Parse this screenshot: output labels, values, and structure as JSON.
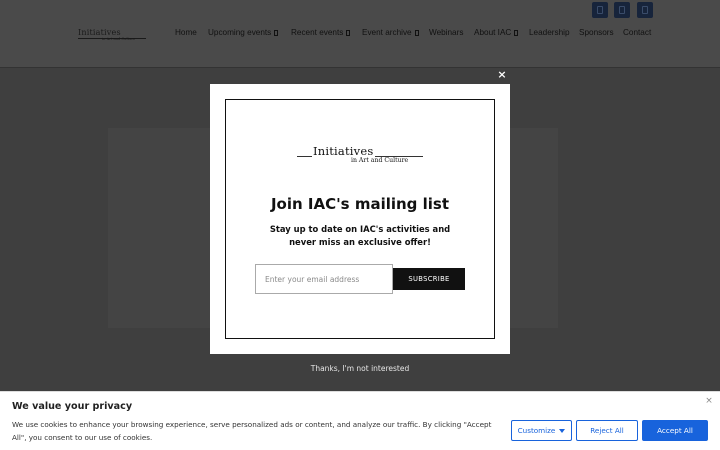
{
  "site": {
    "logo_main": "Initiatives",
    "logo_sub": "in Art and Culture",
    "nav": [
      {
        "label": "Home",
        "has_dropdown": false
      },
      {
        "label": "Upcoming events",
        "has_dropdown": true
      },
      {
        "label": "Recent events",
        "has_dropdown": true
      },
      {
        "label": "Event archive",
        "has_dropdown": true
      },
      {
        "label": "Webinars",
        "has_dropdown": false
      },
      {
        "label": "About IAC",
        "has_dropdown": true
      },
      {
        "label": "Leadership",
        "has_dropdown": false
      },
      {
        "label": "Sponsors",
        "has_dropdown": false
      },
      {
        "label": "Contact",
        "has_dropdown": false
      }
    ],
    "social_icons": [
      "social-icon",
      "social-icon",
      "social-icon"
    ]
  },
  "popup": {
    "close_label": "×",
    "logo_main": "Initiatives",
    "logo_sub": "in Art and Culture",
    "title": "Join IAC's mailing list",
    "text": "Stay up to date on IAC's activities and never miss an exclusive offer!",
    "email_placeholder": "Enter your email address",
    "email_value": "",
    "subscribe_label": "SUBSCRIBE",
    "dismiss_label": "Thanks, I'm not interested"
  },
  "cookie": {
    "title": "We value your privacy",
    "text": "We use cookies to enhance your browsing experience, serve personalized ads or content, and analyze our traffic. By clicking \"Accept All\", you consent to our use of cookies.",
    "close_label": "×",
    "customize_label": "Customize",
    "reject_label": "Reject All",
    "accept_label": "Accept All"
  },
  "colors": {
    "overlay": "#3f3f3f",
    "accent": "#1863dc",
    "social_bg": "#17243b"
  }
}
